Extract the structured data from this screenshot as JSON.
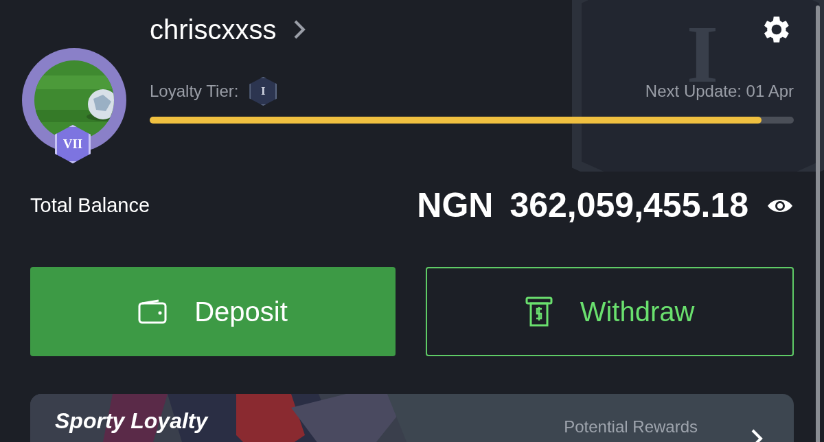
{
  "profile": {
    "username": "chriscxxss",
    "avatar_badge": "VII",
    "tier_label": "Loyalty Tier:",
    "tier_badge": "I",
    "tier_emblem": "I",
    "next_update": "Next Update: 01 Apr",
    "level": 0.95
  },
  "balance": {
    "label": "Total Balance",
    "currency": "NGN",
    "amount": "362,059,455.18"
  },
  "buttons": [
    {
      "kind": "filled",
      "label": "Deposit"
    },
    {
      "kind": "outline",
      "label": "Withdraw"
    }
  ],
  "loyalty_card": {
    "title": "Sporty Loyalty",
    "subtitle": "Potential Rewards"
  }
}
